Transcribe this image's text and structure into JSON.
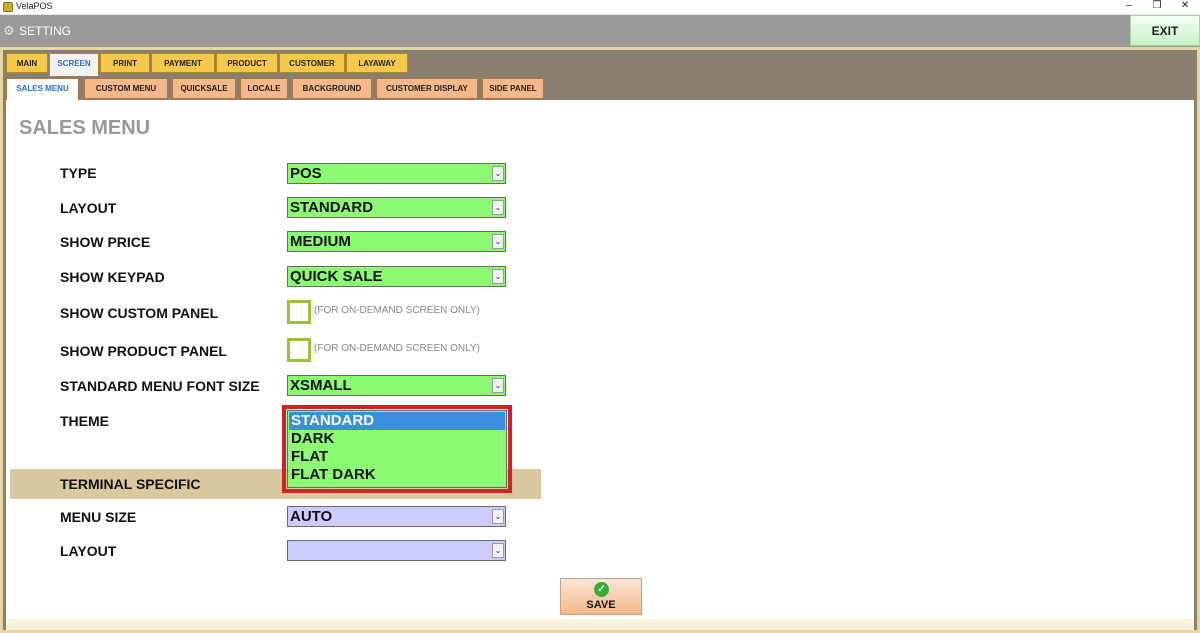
{
  "window": {
    "app_title": "VelaPOS",
    "minimize": "–",
    "restore": "❐",
    "close": "✕"
  },
  "header": {
    "title": "SETTING",
    "gear_icon": "⚙",
    "exit_label": "EXIT"
  },
  "tabs_primary": [
    {
      "label": "MAIN",
      "active": false
    },
    {
      "label": "SCREEN",
      "active": true
    },
    {
      "label": "PRINT",
      "active": false
    },
    {
      "label": "PAYMENT",
      "active": false
    },
    {
      "label": "PRODUCT",
      "active": false
    },
    {
      "label": "CUSTOMER",
      "active": false
    },
    {
      "label": "LAYAWAY",
      "active": false
    }
  ],
  "tabs_secondary": [
    {
      "label": "SALES MENU",
      "active": true
    },
    {
      "label": "CUSTOM MENU",
      "active": false
    },
    {
      "label": "QUICKSALE",
      "active": false
    },
    {
      "label": "LOCALE",
      "active": false
    },
    {
      "label": "BACKGROUND",
      "active": false
    },
    {
      "label": "CUSTOMER DISPLAY",
      "active": false
    },
    {
      "label": "SIDE PANEL",
      "active": false
    }
  ],
  "page": {
    "heading": "SALES MENU"
  },
  "form": {
    "type": {
      "label": "TYPE",
      "value": "POS"
    },
    "layout": {
      "label": "LAYOUT",
      "value": "STANDARD"
    },
    "show_price": {
      "label": "SHOW PRICE",
      "value": "MEDIUM"
    },
    "show_keypad": {
      "label": "SHOW KEYPAD",
      "value": "QUICK SALE"
    },
    "show_custom_panel": {
      "label": "SHOW CUSTOM PANEL",
      "checked": false,
      "note": "(FOR ON-DEMAND SCREEN ONLY)"
    },
    "show_product_panel": {
      "label": "SHOW PRODUCT PANEL",
      "checked": false,
      "note": "(FOR ON-DEMAND SCREEN ONLY)"
    },
    "font_size": {
      "label": "STANDARD MENU FONT SIZE",
      "value": "XSMALL"
    },
    "theme": {
      "label": "THEME",
      "options": [
        "STANDARD",
        "DARK",
        "FLAT",
        "FLAT DARK"
      ],
      "selected": "STANDARD"
    }
  },
  "terminal": {
    "section_label": "TERMINAL SPECIFIC",
    "menu_size": {
      "label": "MENU SIZE",
      "value": "AUTO"
    },
    "layout": {
      "label": "LAYOUT",
      "value": ""
    }
  },
  "dropdown_arrow": "⌄",
  "save": {
    "label": "SAVE",
    "icon": "✓"
  },
  "colors": {
    "field_green": "#8cfa72",
    "field_lavender": "#ccccff",
    "highlight_red": "#d92020",
    "selected_blue": "#3a8ee0"
  }
}
